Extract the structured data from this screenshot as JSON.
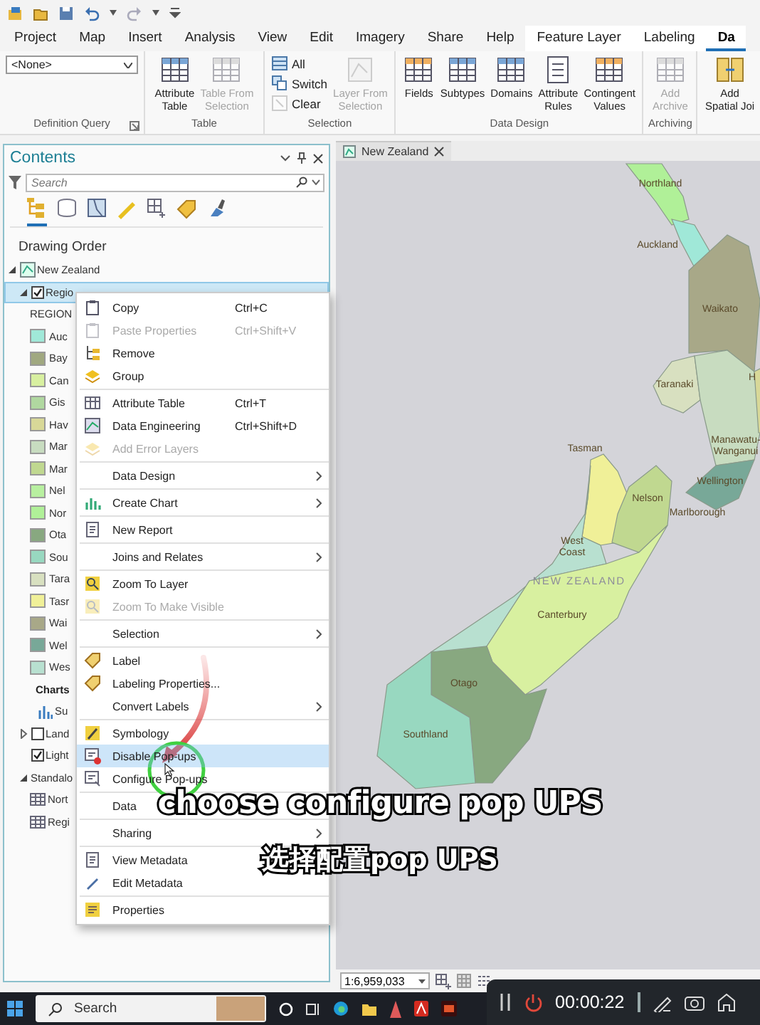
{
  "ribbon": {
    "tabs": [
      {
        "label": "Project",
        "selected": false,
        "contextual": false
      },
      {
        "label": "Map",
        "selected": false,
        "contextual": false
      },
      {
        "label": "Insert",
        "selected": false,
        "contextual": false
      },
      {
        "label": "Analysis",
        "selected": false,
        "contextual": false
      },
      {
        "label": "View",
        "selected": false,
        "contextual": false
      },
      {
        "label": "Edit",
        "selected": false,
        "contextual": false
      },
      {
        "label": "Imagery",
        "selected": false,
        "contextual": false
      },
      {
        "label": "Share",
        "selected": false,
        "contextual": false
      },
      {
        "label": "Help",
        "selected": false,
        "contextual": false
      },
      {
        "label": "Feature Layer",
        "selected": false,
        "contextual": true
      },
      {
        "label": "Labeling",
        "selected": false,
        "contextual": true
      },
      {
        "label": "Da",
        "selected": true,
        "contextual": true
      }
    ],
    "groups": [
      {
        "title": "Definition Query",
        "controls": [
          {
            "kind": "dropdown",
            "value": "<None>"
          }
        ]
      },
      {
        "title": "Table",
        "controls": [
          {
            "kind": "large",
            "label": "Attribute\nTable",
            "disabled": false
          },
          {
            "kind": "large",
            "label": "Table From\nSelection",
            "disabled": true
          }
        ]
      },
      {
        "title": "Selection",
        "controls": [
          {
            "kind": "stack",
            "items": [
              {
                "label": "All",
                "disabled": false
              },
              {
                "label": "Switch",
                "disabled": false
              },
              {
                "label": "Clear",
                "disabled": true
              }
            ]
          },
          {
            "kind": "large",
            "label": "Layer From\nSelection",
            "disabled": true
          }
        ]
      },
      {
        "title": "Data Design",
        "controls": [
          {
            "kind": "large",
            "label": "Fields",
            "disabled": false
          },
          {
            "kind": "large",
            "label": "Subtypes",
            "disabled": false
          },
          {
            "kind": "large",
            "label": "Domains",
            "disabled": false
          },
          {
            "kind": "large",
            "label": "Attribute\nRules",
            "disabled": false
          },
          {
            "kind": "large",
            "label": "Contingent\nValues",
            "disabled": false
          }
        ]
      },
      {
        "title": "Archiving",
        "controls": [
          {
            "kind": "large",
            "label": "Add\nArchive",
            "disabled": true
          }
        ]
      },
      {
        "controls": [
          {
            "kind": "large",
            "label": "Add\nSpatial Joi",
            "disabled": false
          }
        ]
      }
    ]
  },
  "contents": {
    "title": "Contents",
    "search": {
      "placeholder": "Search"
    },
    "views": [
      {
        "selected": true
      },
      {
        "selected": false
      },
      {
        "selected": false
      },
      {
        "selected": false
      },
      {
        "selected": false
      },
      {
        "selected": false
      },
      {
        "selected": false
      }
    ],
    "heading": "Drawing Order",
    "tree": [
      {
        "label": "New Zealand",
        "kind": "map",
        "expanded": true,
        "children": [
          {
            "label": "Regio",
            "kind": "layer",
            "expanded": true,
            "checked": true,
            "selected": true,
            "children": [
              {
                "label": "REGION",
                "kind": "field"
              },
              {
                "label": "Auc",
                "kind": "legend",
                "color": "#a0e8d8"
              },
              {
                "label": "Bay",
                "kind": "legend",
                "color": "#a0a880"
              },
              {
                "label": "Can",
                "kind": "legend",
                "color": "#d8f0a0"
              },
              {
                "label": "Gis",
                "kind": "legend",
                "color": "#b0d8a0"
              },
              {
                "label": "Hav",
                "kind": "legend",
                "color": "#d8d898"
              },
              {
                "label": "Mar",
                "kind": "legend",
                "color": "#c8dcc0"
              },
              {
                "label": "Mar",
                "kind": "legend",
                "color": "#c0d890"
              },
              {
                "label": "Nel",
                "kind": "legend",
                "color": "#b8f0a0"
              },
              {
                "label": "Nor",
                "kind": "legend",
                "color": "#b0f098"
              },
              {
                "label": "Ota",
                "kind": "legend",
                "color": "#88a880"
              },
              {
                "label": "Sou",
                "kind": "legend",
                "color": "#98d8c0"
              },
              {
                "label": "Tara",
                "kind": "legend",
                "color": "#d8e0c0"
              },
              {
                "label": "Tasr",
                "kind": "legend",
                "color": "#f0f098"
              },
              {
                "label": "Wai",
                "kind": "legend",
                "color": "#a8a888"
              },
              {
                "label": "Wel",
                "kind": "legend",
                "color": "#78a898"
              },
              {
                "label": "Wes",
                "kind": "legend",
                "color": "#b8e0d0"
              },
              {
                "label": "Charts",
                "kind": "heading"
              },
              {
                "label": "Su",
                "kind": "chart"
              }
            ]
          },
          {
            "label": "Land",
            "kind": "layer",
            "expanded": false,
            "checked": false,
            "selected": false
          },
          {
            "label": "Light",
            "kind": "layer",
            "checked": true,
            "selected": false
          },
          {
            "label": "Standalo",
            "kind": "group",
            "expanded": true,
            "children": [
              {
                "label": "Nort",
                "kind": "table"
              },
              {
                "label": "Regi",
                "kind": "table"
              }
            ]
          }
        ]
      }
    ]
  },
  "menu": {
    "groups": [
      [
        {
          "label": "Copy",
          "shortcut": "Ctrl+C",
          "disabled": false,
          "submenu": false,
          "selected": false
        },
        {
          "label": "Paste Properties",
          "shortcut": "Ctrl+Shift+V",
          "disabled": true,
          "submenu": false,
          "selected": false
        },
        {
          "label": "Remove",
          "disabled": false,
          "submenu": false,
          "selected": false
        },
        {
          "label": "Group",
          "disabled": false,
          "submenu": false,
          "selected": false
        }
      ],
      [
        {
          "label": "Attribute Table",
          "shortcut": "Ctrl+T",
          "disabled": false,
          "submenu": false,
          "selected": false
        },
        {
          "label": "Data Engineering",
          "shortcut": "Ctrl+Shift+D",
          "disabled": false,
          "submenu": false,
          "selected": false
        },
        {
          "label": "Add Error Layers",
          "disabled": true,
          "submenu": false,
          "selected": false
        }
      ],
      [
        {
          "label": "Data Design",
          "disabled": false,
          "submenu": true,
          "selected": false
        }
      ],
      [
        {
          "label": "Create Chart",
          "disabled": false,
          "submenu": true,
          "selected": false
        }
      ],
      [
        {
          "label": "New Report",
          "disabled": false,
          "submenu": false,
          "selected": false
        }
      ],
      [
        {
          "label": "Joins and Relates",
          "disabled": false,
          "submenu": true,
          "selected": false
        }
      ],
      [
        {
          "label": "Zoom To Layer",
          "disabled": false,
          "submenu": false,
          "selected": false
        },
        {
          "label": "Zoom To Make Visible",
          "disabled": true,
          "submenu": false,
          "selected": false
        }
      ],
      [
        {
          "label": "Selection",
          "disabled": false,
          "submenu": true,
          "selected": false
        }
      ],
      [
        {
          "label": "Label",
          "disabled": false,
          "submenu": false,
          "selected": false
        },
        {
          "label": "Labeling Properties...",
          "disabled": false,
          "submenu": false,
          "selected": false
        },
        {
          "label": "Convert Labels",
          "disabled": false,
          "submenu": true,
          "selected": false
        }
      ],
      [
        {
          "label": "Symbology",
          "disabled": false,
          "submenu": false,
          "selected": false
        },
        {
          "label": "Disable Pop-ups",
          "disabled": false,
          "submenu": false,
          "selected": true
        },
        {
          "label": "Configure Pop-ups",
          "disabled": false,
          "submenu": false,
          "selected": false
        }
      ],
      [
        {
          "label": "Data",
          "disabled": false,
          "submenu": false,
          "selected": false
        }
      ],
      [
        {
          "label": "Sharing",
          "disabled": false,
          "submenu": true,
          "selected": false
        }
      ],
      [
        {
          "label": "View Metadata",
          "disabled": false,
          "submenu": false,
          "selected": false
        },
        {
          "label": "Edit Metadata",
          "disabled": false,
          "submenu": false,
          "selected": false
        }
      ],
      [
        {
          "label": "Properties",
          "disabled": false,
          "submenu": false,
          "selected": false
        }
      ]
    ]
  },
  "map": {
    "tab": {
      "label": "New Zealand"
    },
    "labels": [
      "Northland",
      "Auckland",
      "Waikato",
      "Taranaki",
      "H",
      "Manawatu-Wanganui",
      "Wellington",
      "Tasman",
      "Nelson",
      "Marlborough",
      "West Coast",
      "NEW ZEALAND",
      "Canterbury",
      "Otago",
      "Southland"
    ],
    "scale": "1:6,959,033"
  },
  "taskbar": {
    "search": {
      "placeholder": "Search"
    }
  },
  "recorder": {
    "time": "00:00:22"
  },
  "captions": [
    "choose configure pop UPS",
    "选择配置pop UPS"
  ]
}
